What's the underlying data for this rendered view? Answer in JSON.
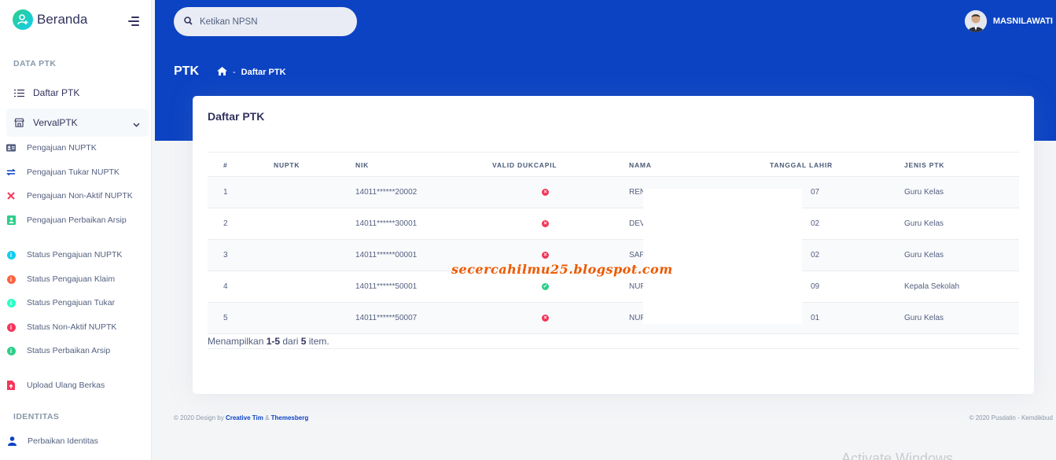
{
  "brand": {
    "name": "Beranda"
  },
  "sidebar": {
    "section_ptk": "DATA PTK",
    "daftar_ptk": "Daftar PTK",
    "verval_ptk": "VervalPTK",
    "sub_items": [
      {
        "label": "Pengajuan NUPTK",
        "icon": "id-card-icon",
        "color": "#525f7f"
      },
      {
        "label": "Pengajuan Tukar NUPTK",
        "icon": "exchange-icon",
        "color": "#0c43c3"
      },
      {
        "label": "Pengajuan Non-Aktif NUPTK",
        "icon": "x-icon",
        "color": "#f5365c"
      },
      {
        "label": "Pengajuan Perbaikan Arsip",
        "icon": "user-card-icon",
        "color": "#2dce89"
      },
      {
        "label": "Status Pengajuan NUPTK",
        "icon": "info-icon",
        "color": "#11cdef"
      },
      {
        "label": "Status Pengajuan Klaim",
        "icon": "info-icon",
        "color": "#fb6340"
      },
      {
        "label": "Status Pengajuan Tukar",
        "icon": "info-icon",
        "color": "#2bffc6"
      },
      {
        "label": "Status Non-Aktif NUPTK",
        "icon": "info-icon",
        "color": "#f5365c"
      },
      {
        "label": "Status Perbaikan Arsip",
        "icon": "info-icon",
        "color": "#2dce89"
      },
      {
        "label": "Upload Ulang Berkas",
        "icon": "file-upload-icon",
        "color": "#f5365c"
      }
    ],
    "section_identitas": "IDENTITAS",
    "perbaikan_identitas": "Perbaikan Identitas"
  },
  "header": {
    "search_placeholder": "Ketikan NPSN",
    "username": "MASNILAWATI",
    "page_title": "PTK",
    "breadcrumb_sep": "-",
    "breadcrumb_current": "Daftar PTK"
  },
  "card": {
    "title": "Daftar PTK",
    "columns": [
      "#",
      "NUPTK",
      "NIK",
      "VALID DUKCAPIL",
      "NAMA",
      "TANGGAL LAHIR",
      "JENIS PTK"
    ],
    "rows": [
      {
        "no": "1",
        "nuptk": "",
        "nik": "14011******20002",
        "valid": false,
        "nama": "REN",
        "tgl": "07",
        "jenis": "Guru Kelas"
      },
      {
        "no": "2",
        "nuptk": "",
        "nik": "14011******30001",
        "valid": false,
        "nama": "DEV",
        "tgl": "02",
        "jenis": "Guru Kelas"
      },
      {
        "no": "3",
        "nuptk": "",
        "nik": "14011******00001",
        "valid": false,
        "nama": "SAF",
        "tgl": "02",
        "jenis": "Guru Kelas"
      },
      {
        "no": "4",
        "nuptk": "",
        "nik": "14011******50001",
        "valid": true,
        "nama": "NUF",
        "tgl": "09",
        "jenis": "Kepala Sekolah"
      },
      {
        "no": "5",
        "nuptk": "",
        "nik": "14011******50007",
        "valid": false,
        "nama": "NUF",
        "tgl": "01",
        "jenis": "Guru Kelas"
      }
    ],
    "summary_prefix": "Menampilkan ",
    "summary_range": "1-5",
    "summary_mid": " dari ",
    "summary_total": "5",
    "summary_suffix": " item."
  },
  "watermark": "secercahilmu25.blogspot.com",
  "footer": {
    "left_prefix": "© 2020 Design by",
    "left_link1": "Creative Tim",
    "left_amp": "&",
    "left_link2": "Themesberg",
    "right": "© 2020 Pusdatin - Kemdikbud"
  },
  "activate_windows": "Activate Windows"
}
